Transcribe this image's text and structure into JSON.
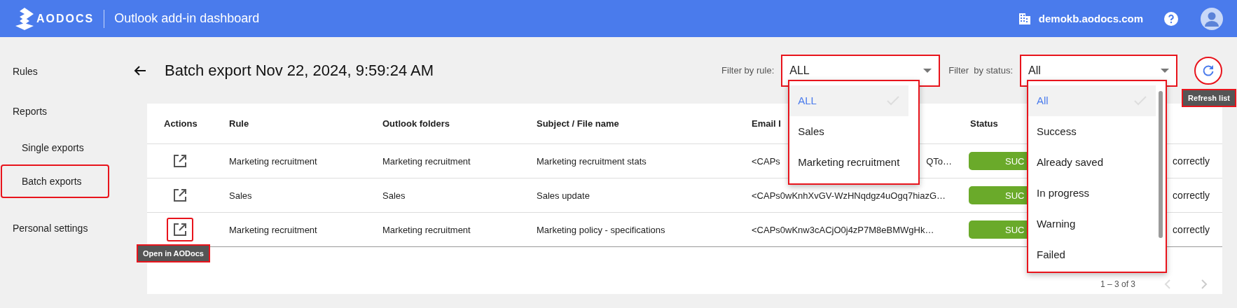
{
  "header": {
    "logo_text": "AODOCS",
    "title": "Outlook add-in dashboard",
    "domain": "demokb.aodocs.com"
  },
  "sidebar": {
    "items": [
      {
        "label": "Rules",
        "selected": false
      },
      {
        "label": "Reports",
        "selected": false,
        "children": [
          {
            "label": "Single exports",
            "selected": false
          },
          {
            "label": "Batch exports",
            "selected": true
          }
        ]
      },
      {
        "label": "Personal settings",
        "selected": false
      }
    ]
  },
  "page": {
    "title": "Batch export Nov 22, 2024, 9:59:24 AM"
  },
  "filters": [
    {
      "label": "Filter by rule:",
      "value": "ALL",
      "options": [
        {
          "label": "ALL",
          "selected": true
        },
        {
          "label": "Sales",
          "selected": false
        },
        {
          "label": "Marketing recruitment",
          "selected": false
        }
      ]
    },
    {
      "label": "Filter  by status:",
      "value": "All",
      "options": [
        {
          "label": "All",
          "selected": true
        },
        {
          "label": "Success",
          "selected": false
        },
        {
          "label": "Already saved",
          "selected": false
        },
        {
          "label": "In progress",
          "selected": false
        },
        {
          "label": "Warning",
          "selected": false
        },
        {
          "label": "Failed",
          "selected": false
        }
      ]
    }
  ],
  "refresh_tooltip": "Refresh list",
  "table": {
    "columns": [
      "Actions",
      "Rule",
      "Outlook folders",
      "Subject / File name",
      "Email I",
      "Status"
    ],
    "action_tooltip": "Open in AODocs",
    "rows": [
      {
        "rule": "Marketing recruitment",
        "folder": "Marketing recruitment",
        "subject": "Marketing recruitment stats",
        "email": "<CAPs",
        "email_tail": "QTo…",
        "status": "SUC",
        "result": "correctly",
        "highlighted": false
      },
      {
        "rule": "Sales",
        "folder": "Sales",
        "subject": "Sales update",
        "email": "<CAPs0wKnhXvGV-WzHNqdgz4uOgq7hiazG…",
        "status": "SUC",
        "result": "correctly",
        "highlighted": false
      },
      {
        "rule": "Marketing recruitment",
        "folder": "Marketing recruitment",
        "subject": "Marketing policy - specifications",
        "email": "<CAPs0wKnw3cACjO0j4zP7M8eBMWgHk…",
        "status": "SUC",
        "result": "correctly",
        "highlighted": true
      }
    ],
    "pagination": "1 – 3 of 3"
  }
}
